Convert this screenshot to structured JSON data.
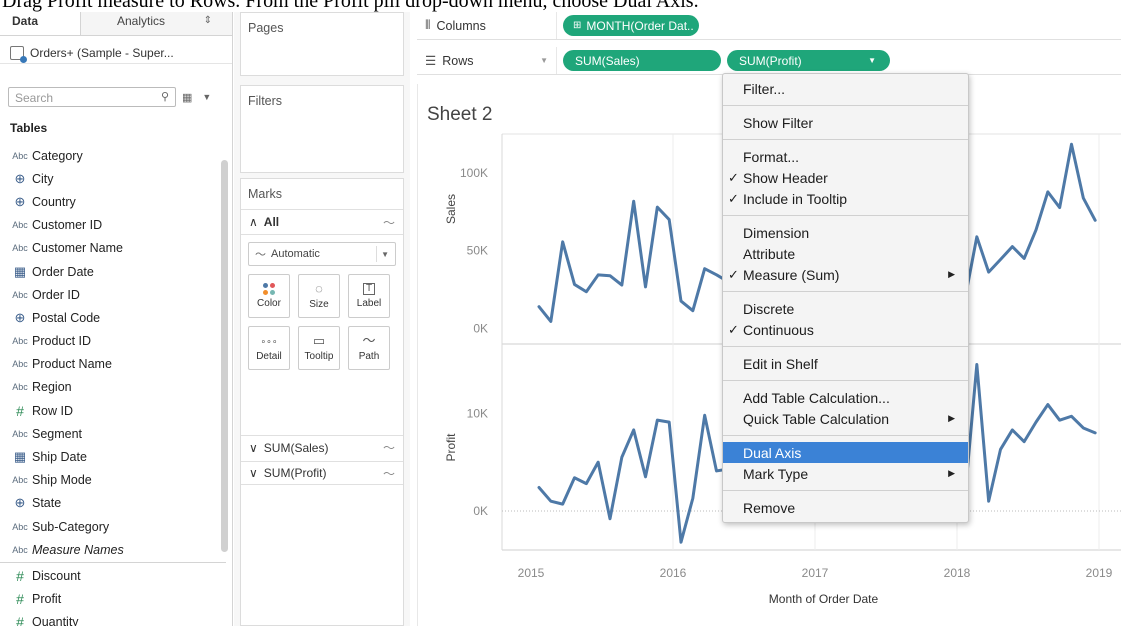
{
  "caption": "Drag Profit measure to Rows. From the Profit pill drop-down menu, choose Dual Axis.",
  "data_pane": {
    "tab_data": "Data",
    "tab_analytics": "Analytics",
    "datasource": "Orders+ (Sample - Super...",
    "search_placeholder": "Search",
    "tables_heading": "Tables",
    "fields": [
      {
        "type": "Abc",
        "name": "Category"
      },
      {
        "type": "globe",
        "name": "City"
      },
      {
        "type": "globe",
        "name": "Country"
      },
      {
        "type": "Abc",
        "name": "Customer ID"
      },
      {
        "type": "Abc",
        "name": "Customer Name"
      },
      {
        "type": "date",
        "name": "Order Date"
      },
      {
        "type": "Abc",
        "name": "Order ID"
      },
      {
        "type": "globe",
        "name": "Postal Code"
      },
      {
        "type": "Abc",
        "name": "Product ID"
      },
      {
        "type": "Abc",
        "name": "Product Name"
      },
      {
        "type": "Abc",
        "name": "Region"
      },
      {
        "type": "#",
        "name": "Row ID"
      },
      {
        "type": "Abc",
        "name": "Segment"
      },
      {
        "type": "date",
        "name": "Ship Date"
      },
      {
        "type": "Abc",
        "name": "Ship Mode"
      },
      {
        "type": "globe",
        "name": "State"
      },
      {
        "type": "Abc",
        "name": "Sub-Category"
      },
      {
        "type": "Abc",
        "name": "Measure Names",
        "italic": true
      }
    ],
    "measures": [
      {
        "type": "#",
        "name": "Discount"
      },
      {
        "type": "#",
        "name": "Profit"
      },
      {
        "type": "#",
        "name": "Quantity"
      }
    ]
  },
  "cards": {
    "pages": "Pages",
    "filters": "Filters",
    "marks": "Marks",
    "marks_all": "All",
    "mark_type": "Automatic",
    "buttons": [
      "Color",
      "Size",
      "Label",
      "Detail",
      "Tooltip",
      "Path"
    ],
    "shelf_sales": "SUM(Sales)",
    "shelf_profit": "SUM(Profit)"
  },
  "shelves": {
    "columns_label": "Columns",
    "rows_label": "Rows",
    "columns_pill": "MONTH(Order Dat..",
    "rows_pill_1": "SUM(Sales)",
    "rows_pill_2": "SUM(Profit)"
  },
  "sheet": {
    "title": "Sheet 2",
    "line_color": "#4e79a7"
  },
  "chart_data": {
    "type": "line",
    "xlabel": "Month of Order Date",
    "x_ticks": [
      "2015",
      "2016",
      "2017",
      "2018",
      "2019"
    ],
    "panes": [
      {
        "ylabel": "Sales",
        "y_ticks": [
          "0K",
          "50K",
          "100K"
        ],
        "ylim": [
          -10000,
          125000
        ],
        "visible_segments": [
          {
            "x": [
              "2015-01",
              "2015-02",
              "2015-03",
              "2015-04",
              "2015-05",
              "2015-06",
              "2015-07",
              "2015-08",
              "2015-09",
              "2015-10",
              "2015-11",
              "2015-12",
              "2016-01",
              "2016-02",
              "2016-03",
              "2016-04",
              "2016-05"
            ],
            "y": [
              14000,
              4500,
              55700,
              28300,
              23600,
              34400,
              33900,
              27900,
              81800,
              26700,
              78000,
              70000,
              17600,
              11400,
              38400,
              34500,
              30000
            ]
          },
          {
            "x": [
              "2018-01",
              "2018-02",
              "2018-03",
              "2018-04",
              "2018-05",
              "2018-06",
              "2018-07",
              "2018-08",
              "2018-09",
              "2018-10",
              "2018-11",
              "2018-12"
            ],
            "y": [
              19000,
              58900,
              36200,
              44300,
              52600,
              45000,
              63300,
              87800,
              77700,
              118400,
              83800,
              69500
            ]
          }
        ]
      },
      {
        "ylabel": "Profit",
        "y_ticks": [
          "0K",
          "10K"
        ],
        "ylim": [
          -4000,
          17000
        ],
        "visible_segments": [
          {
            "x": [
              "2015-01",
              "2015-02",
              "2015-03",
              "2015-04",
              "2015-05",
              "2015-06",
              "2015-07",
              "2015-08",
              "2015-09",
              "2015-10",
              "2015-11",
              "2015-12",
              "2016-01",
              "2016-02",
              "2016-03",
              "2016-04",
              "2016-05"
            ],
            "y": [
              2400,
              1000,
              700,
              3400,
              2800,
              5000,
              -800,
              5500,
              8300,
              3500,
              9300,
              9100,
              -3200,
              1300,
              9800,
              4100,
              4300
            ]
          },
          {
            "x": [
              "2018-01",
              "2018-02",
              "2018-03",
              "2018-04",
              "2018-05",
              "2018-06",
              "2018-07",
              "2018-08",
              "2018-09",
              "2018-10",
              "2018-11",
              "2018-12"
            ],
            "y": [
              1500,
              15000,
              1000,
              6300,
              8300,
              7100,
              9100,
              10900,
              9300,
              9700,
              8500,
              8000
            ]
          }
        ]
      }
    ]
  },
  "context_menu": {
    "items": [
      {
        "label": "Filter...",
        "checked": false,
        "submenu": false,
        "sep_after": true
      },
      {
        "label": "Show Filter",
        "checked": false,
        "submenu": false,
        "sep_after": true
      },
      {
        "label": "Format...",
        "checked": false,
        "submenu": false,
        "sep_after": false
      },
      {
        "label": "Show Header",
        "checked": true,
        "submenu": false,
        "sep_after": false
      },
      {
        "label": "Include in Tooltip",
        "checked": true,
        "submenu": false,
        "sep_after": true
      },
      {
        "label": "Dimension",
        "checked": false,
        "submenu": false,
        "sep_after": false
      },
      {
        "label": "Attribute",
        "checked": false,
        "submenu": false,
        "sep_after": false
      },
      {
        "label": "Measure (Sum)",
        "checked": true,
        "submenu": true,
        "sep_after": true
      },
      {
        "label": "Discrete",
        "checked": false,
        "submenu": false,
        "sep_after": false
      },
      {
        "label": "Continuous",
        "checked": true,
        "submenu": false,
        "sep_after": true
      },
      {
        "label": "Edit in Shelf",
        "checked": false,
        "submenu": false,
        "sep_after": true
      },
      {
        "label": "Add Table Calculation...",
        "checked": false,
        "submenu": false,
        "sep_after": false
      },
      {
        "label": "Quick Table Calculation",
        "checked": false,
        "submenu": true,
        "sep_after": true
      },
      {
        "label": "Dual Axis",
        "checked": false,
        "submenu": false,
        "sep_after": false,
        "highlighted": true
      },
      {
        "label": "Mark Type",
        "checked": false,
        "submenu": true,
        "sep_after": true
      },
      {
        "label": "Remove",
        "checked": false,
        "submenu": false,
        "sep_after": false
      }
    ]
  }
}
